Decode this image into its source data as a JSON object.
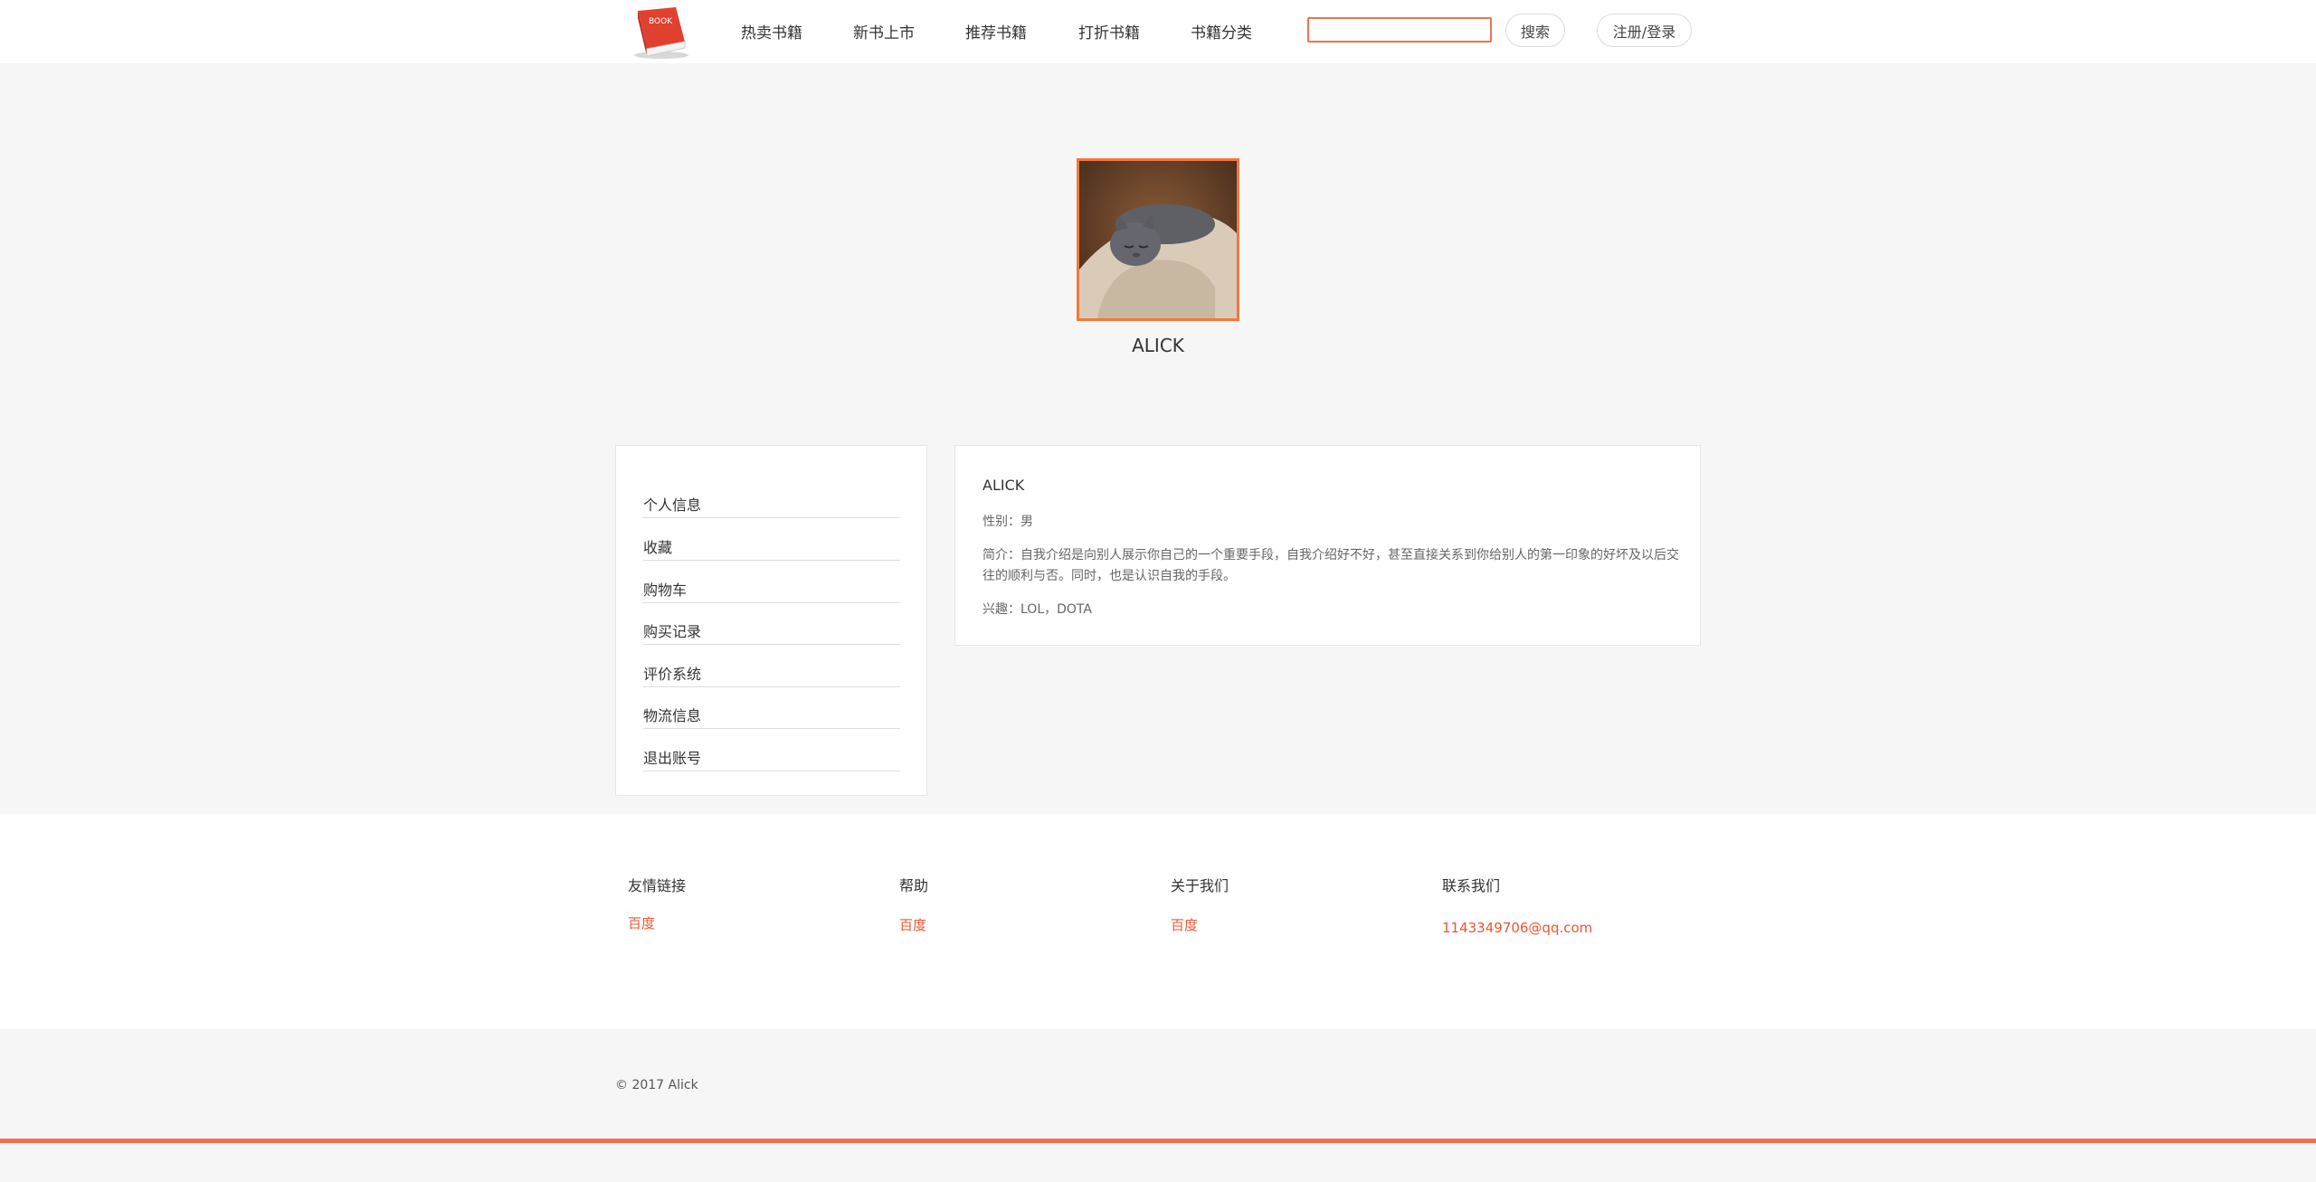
{
  "header": {
    "nav": [
      "热卖书籍",
      "新书上市",
      "推荐书籍",
      "打折书籍",
      "书籍分类"
    ],
    "logo_text": "BOOK",
    "search": {
      "value": "",
      "placeholder": ""
    },
    "search_button": "搜索",
    "login_button": "注册/登录"
  },
  "profile": {
    "username": "ALICK"
  },
  "side_menu": {
    "items": [
      "个人信息",
      "收藏",
      "购物车",
      "购买记录",
      "评价系统",
      "物流信息",
      "退出账号"
    ]
  },
  "info": {
    "name": "ALICK",
    "gender": "性别：男",
    "intro": "简介：自我介绍是向别人展示你自己的一个重要手段，自我介绍好不好，甚至直接关系到你给别人的第一印象的好坏及以后交往的顺利与否。同时，也是认识自我的手段。",
    "hobby": "兴趣：LOL，DOTA"
  },
  "footer": {
    "columns": [
      {
        "title": "友情链接",
        "link": "百度"
      },
      {
        "title": "帮助",
        "link": "百度"
      },
      {
        "title": "关于我们",
        "link": "百度"
      },
      {
        "title": "联系我们",
        "link": "1143349706@qq.com"
      }
    ],
    "copyright": "© 2017 Alick"
  },
  "colors": {
    "accent": "#f07152",
    "link": "#f0552e",
    "avatar_border": "#f07a3a"
  }
}
